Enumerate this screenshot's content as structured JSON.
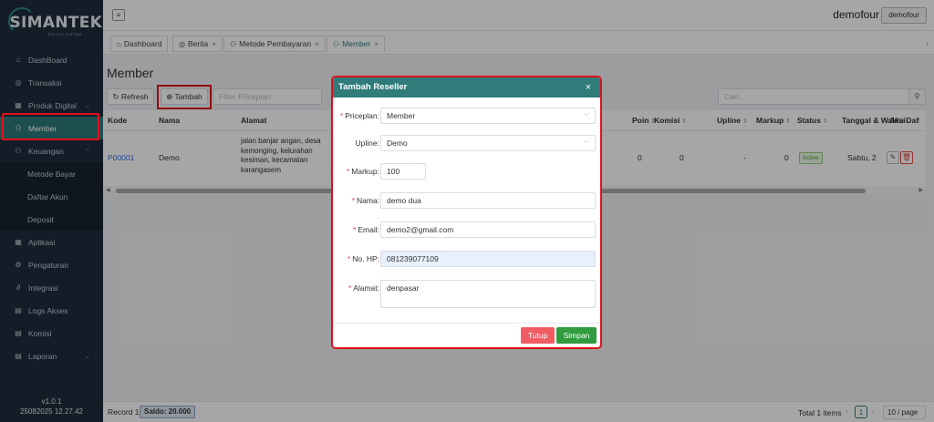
{
  "brand": {
    "name": "SIMANTEK",
    "subtitle": "SOLUSI SISTEM"
  },
  "sidebar": {
    "items": [
      {
        "label": "DashBoard",
        "icon": "home-icon",
        "glyph": "⌂"
      },
      {
        "label": "Transaksi",
        "icon": "transaction-icon",
        "glyph": "◎"
      },
      {
        "label": "Produk Digital",
        "icon": "grid-icon",
        "glyph": "▦",
        "arrow": "⌄"
      },
      {
        "label": "Member",
        "icon": "users-icon",
        "glyph": "⚇"
      },
      {
        "label": "Keuangan",
        "icon": "users-icon",
        "glyph": "⚇",
        "arrow": "⌃"
      },
      {
        "label": "Metode Bayar"
      },
      {
        "label": "Daftar Akun"
      },
      {
        "label": "Deposit"
      },
      {
        "label": "Aplikasi",
        "icon": "grid-icon",
        "glyph": "▦"
      },
      {
        "label": "Pengaturan",
        "icon": "gear-icon",
        "glyph": "⚙"
      },
      {
        "label": "Integrasi",
        "icon": "link-icon",
        "glyph": "∂"
      },
      {
        "label": "Logs Akses",
        "icon": "document-icon",
        "glyph": "▤"
      },
      {
        "label": "Komisi",
        "icon": "document-icon",
        "glyph": "▤"
      },
      {
        "label": "Laporan",
        "icon": "document-icon",
        "glyph": "▤",
        "arrow": "⌄"
      }
    ],
    "version": "v1.0.1",
    "build": "25082025 12.27.42"
  },
  "topbar": {
    "menu_glyph": "≡",
    "username": "demofour",
    "user_button": "demofour"
  },
  "tabs": [
    {
      "label": "Dashboard",
      "glyph": "⌂"
    },
    {
      "label": "Berita",
      "glyph": "◎",
      "close": "×"
    },
    {
      "label": "Metode Pembayaran",
      "glyph": "⚇",
      "close": "×"
    },
    {
      "label": "Member",
      "glyph": "⚇",
      "close": "×"
    }
  ],
  "tabs_more": "›",
  "main": {
    "title": "Member",
    "refresh": "Refresh",
    "refresh_glyph": "↻",
    "tambah": "Tambah",
    "tambah_glyph": "⊕",
    "filter_placeholder": "Filter Priceplan",
    "search_placeholder": "Cari...",
    "search_glyph": "⚲"
  },
  "table": {
    "columns": {
      "kode": "Kode",
      "nama": "Nama",
      "alamat": "Alamat",
      "poin": "Poin",
      "komisi": "Komisi",
      "upline": "Upline",
      "markup": "Markup",
      "status": "Status",
      "tanggal": "Tanggal & Waktu Daftar",
      "aksi": "Aksi"
    },
    "sort_glyph": "⇕",
    "row": {
      "kode": "P00001",
      "nama": "Demo",
      "alamat": "jalan banjar angan, desa kemonging, kelurahan kesiman, kecamatan karangasem",
      "poin": "0",
      "komisi": "0",
      "upline": "-",
      "markup": "0",
      "status": "Active",
      "tanggal": "Sabtu, 2",
      "edit_glyph": "✎",
      "delete_glyph": "🗑"
    }
  },
  "footer": {
    "record": "Record 1",
    "saldo": "Saldo: 20.000",
    "total": "Total 1 items",
    "prev": "‹",
    "page": "1",
    "next": "›",
    "page_size": "10 / page"
  },
  "modal": {
    "title": "Tambah Reseller",
    "close": "×",
    "required_mark": "*",
    "fields": {
      "priceplan": {
        "label": "Priceplan:",
        "value": "Member"
      },
      "upline": {
        "label": "Upline:",
        "value": "Demo"
      },
      "markup": {
        "label": "Markup:",
        "value": "100"
      },
      "nama": {
        "label": "Nama:",
        "value": "demo dua"
      },
      "email": {
        "label": "Email:",
        "value": "demo2@gmail.com"
      },
      "nohp": {
        "label": "No. HP:",
        "value": "081239077109"
      },
      "alamat": {
        "label": "Alamat:",
        "value": "denpasar"
      }
    },
    "tutup": "Tutup",
    "simpan": "Simpan"
  },
  "colors": {
    "sidebar_bg": "#1f2d3d",
    "accent": "#2e7a7a",
    "highlight": "#e0101c",
    "danger": "#f25c63",
    "success": "#2f9c3f"
  }
}
